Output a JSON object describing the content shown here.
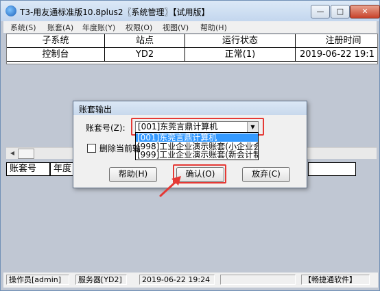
{
  "window": {
    "title": "T3-用友通标准版10.8plus2〖系统管理〗【试用版】",
    "buttons": {
      "minimize": "—",
      "maximize": "□",
      "close": "✕"
    }
  },
  "menubar": [
    "系统(S)",
    "账套(A)",
    "年度账(Y)",
    "权限(O)",
    "视图(V)",
    "帮助(H)"
  ],
  "top_table": {
    "headers": [
      "子系统",
      "站点",
      "运行状态",
      "注册时间"
    ],
    "row": [
      "控制台",
      "YD2",
      "正常(1)",
      "2019-06-22 19:1"
    ]
  },
  "bottom_table": {
    "headers": [
      "账套号",
      "年度"
    ]
  },
  "dialog": {
    "title": "账套输出",
    "account_label": "账套号(Z):",
    "selected": "[001]东莞言鼎计算机",
    "options": [
      "[001]东莞言鼎计算机",
      "[998]工业企业演示账套(小企业会",
      "[999]工业企业演示账套(新会计制"
    ],
    "checkbox_label": "删除当前输",
    "help_button": "帮助(H)",
    "confirm_button": "确认(O)",
    "cancel_button": "放弃(C)"
  },
  "statusbar": {
    "operator": "操作员[admin]",
    "server": "服务器[YD2]",
    "time": "2019-06-22 19:24",
    "vendor": "【畅捷通软件】"
  },
  "colors": {
    "accent": "#e53935",
    "selection": "#3399ff"
  },
  "icons": {
    "app": "app-logo-icon",
    "dropdown": "chevron-down-icon",
    "arrow": "annotation-arrow-icon"
  }
}
